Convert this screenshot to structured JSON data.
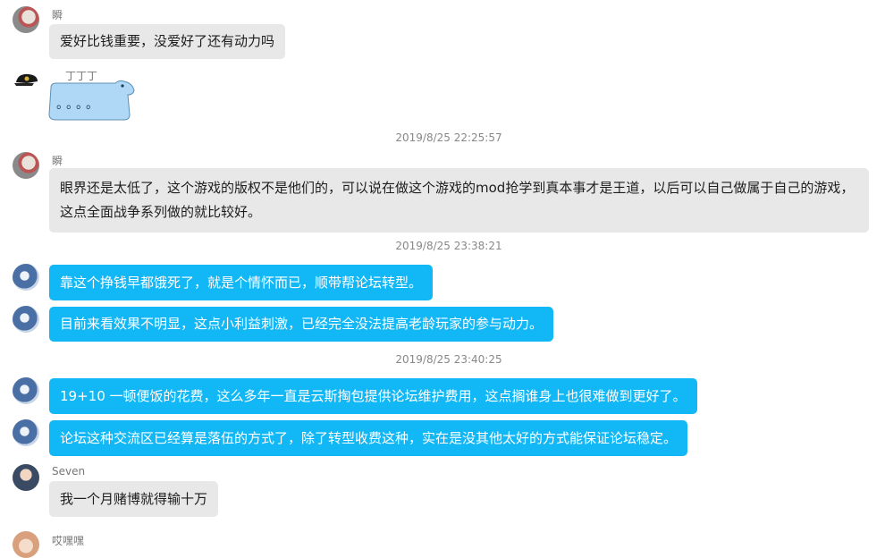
{
  "messages": [
    {
      "sender": "瞬",
      "text": "爱好比钱重要，没爱好了还有动力吗"
    },
    {
      "sender": "丁丁丁",
      "text": "。。。。"
    },
    {
      "sender": "瞬",
      "text": "眼界还是太低了，这个游戏的版权不是他们的，可以说在做这个游戏的mod抢学到真本事才是王道，以后可以自己做属于自己的游戏，这点全面战争系列做的就比较好。"
    },
    {
      "text": "靠这个挣钱早都饿死了，就是个情怀而已，顺带帮论坛转型。"
    },
    {
      "text": "目前来看效果不明显，这点小利益刺激，已经完全没法提高老龄玩家的参与动力。"
    },
    {
      "text": "19+10 一顿便饭的花费，这么多年一直是云斯掏包提供论坛维护费用，这点搁谁身上也很难做到更好了。"
    },
    {
      "text": "论坛这种交流区已经算是落伍的方式了，除了转型收费这种，实在是没其他太好的方式能保证论坛稳定。"
    },
    {
      "sender": "Seven",
      "text": "我一个月赌博就得输十万"
    },
    {
      "sender": "哎嘿嘿"
    }
  ],
  "timestamps": [
    "2019/8/25 22:25:57",
    "2019/8/25 23:38:21",
    "2019/8/25 23:40:25"
  ]
}
